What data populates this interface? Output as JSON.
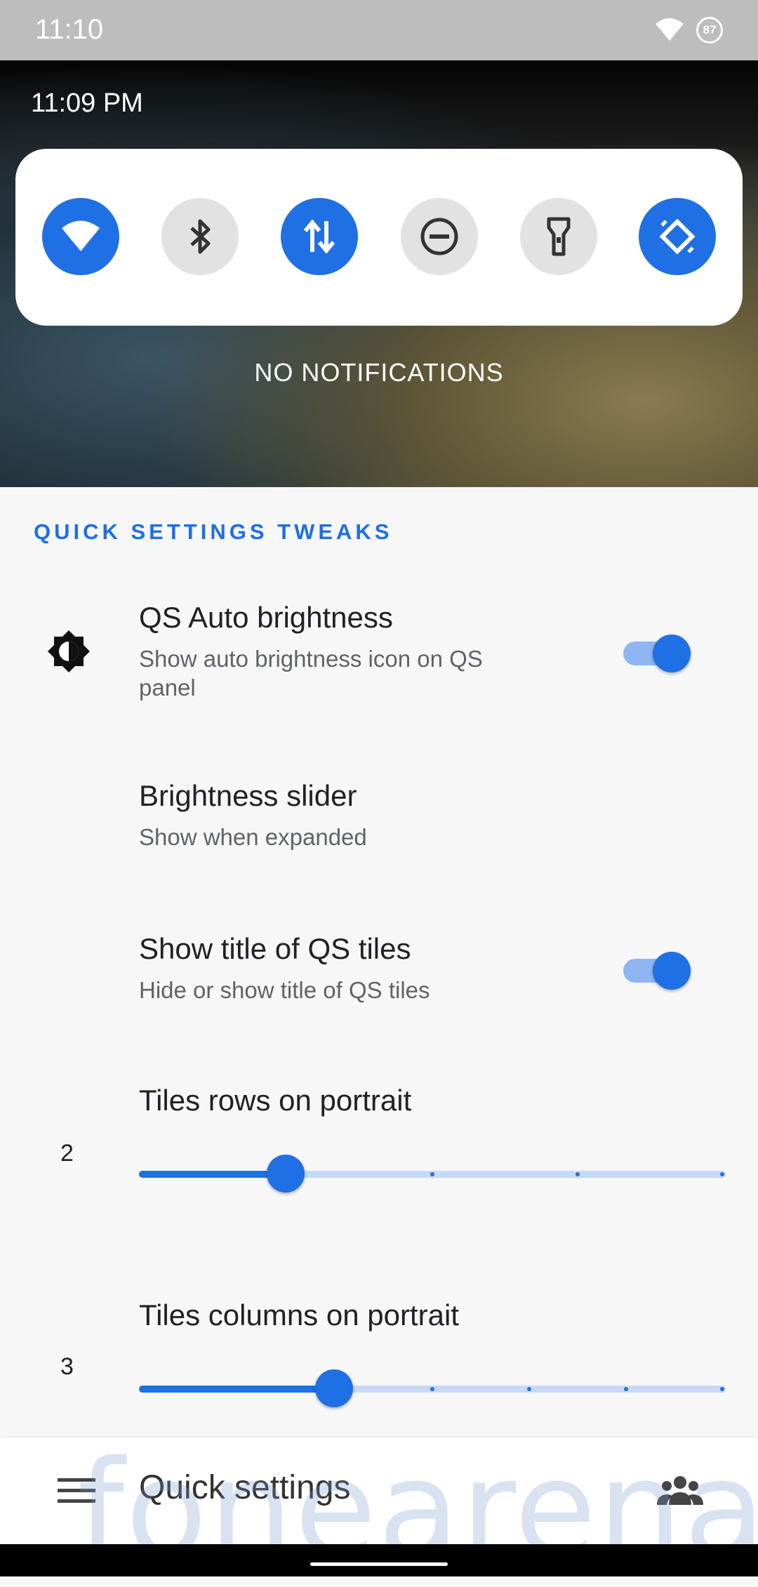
{
  "status_bar": {
    "time": "11:10",
    "battery": "87"
  },
  "shade": {
    "clock": "11:09 PM",
    "tiles": [
      {
        "name": "wifi",
        "state": "on"
      },
      {
        "name": "bluetooth",
        "state": "off"
      },
      {
        "name": "mobile-data",
        "state": "on"
      },
      {
        "name": "do-not-disturb",
        "state": "off"
      },
      {
        "name": "flashlight",
        "state": "off"
      },
      {
        "name": "auto-rotate",
        "state": "on"
      }
    ],
    "empty_text": "NO NOTIFICATIONS"
  },
  "section": {
    "title": "QUICK SETTINGS TWEAKS"
  },
  "prefs": {
    "auto_brightness": {
      "title": "QS Auto brightness",
      "summary": "Show auto brightness icon on QS panel",
      "enabled": true
    },
    "brightness_slider": {
      "title": "Brightness slider",
      "summary": "Show when expanded"
    },
    "show_title": {
      "title": "Show title of QS tiles",
      "summary": "Hide or show title of QS tiles",
      "enabled": true
    },
    "rows": {
      "title": "Tiles rows on portrait",
      "value": "2",
      "level": 0.25
    },
    "columns": {
      "title": "Tiles columns on portrait",
      "value": "3",
      "level": 0.333
    }
  },
  "bottom_bar": {
    "title": "Quick settings",
    "watermark": "fonearena"
  },
  "colors": {
    "accent": "#1f6fe5",
    "accent_light": "#8fb5f2",
    "tile_off": "#e2e2e2"
  }
}
